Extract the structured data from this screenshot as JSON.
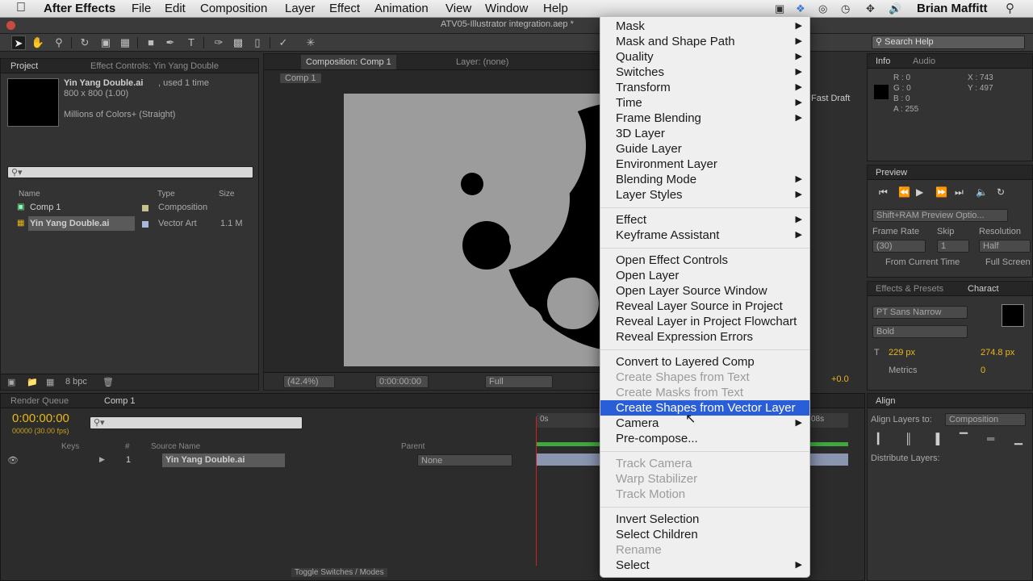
{
  "menubar": {
    "app": "After Effects",
    "items": [
      "File",
      "Edit",
      "Composition",
      "Layer",
      "Effect",
      "Animation",
      "View",
      "Window",
      "Help"
    ],
    "user": "Brian Maffitt"
  },
  "window": {
    "title": "ATV05-Illustrator integration.aep *",
    "search_placeholder": "Search Help"
  },
  "project": {
    "tab_project": "Project",
    "tab_effect": "Effect Controls: Yin Yang Double",
    "item_name": "Yin Yang Double.ai",
    "used": ", used 1 time",
    "size": "800 x 800 (1.00)",
    "colors": "Millions of Colors+ (Straight)",
    "col_name": "Name",
    "col_type": "Type",
    "col_size": "Size",
    "rows": [
      {
        "name": "Comp 1",
        "type": "Composition",
        "size": ""
      },
      {
        "name": "Yin Yang Double.ai",
        "type": "Vector Art",
        "size": "1.1 M"
      }
    ],
    "bpc": "8 bpc"
  },
  "comp": {
    "tab": "Composition: Comp 1",
    "layer_tab": "Layer: (none)",
    "crumb": "Comp 1",
    "zoom": "(42.4%)",
    "time": "0:00:00:00",
    "quality": "Full",
    "fast_draft": "Fast Draft",
    "exposure": "+0.0"
  },
  "info": {
    "tab": "Info",
    "audio_tab": "Audio",
    "r": "R : 0",
    "g": "G : 0",
    "b": "B : 0",
    "a": "A : 255",
    "x": "X : 743",
    "y": "Y : 497"
  },
  "preview": {
    "tab": "Preview",
    "ram": "Shift+RAM Preview Optio...",
    "frame_rate_label": "Frame Rate",
    "skip_label": "Skip",
    "resolution_label": "Resolution",
    "frame_rate": "(30)",
    "skip": "1",
    "resolution": "Half",
    "from_current": "From Current Time",
    "full_screen": "Full Screen"
  },
  "character": {
    "tab_effects": "Effects & Presets",
    "tab_char": "Charact",
    "font": "PT Sans Narrow",
    "style": "Bold",
    "size": "229 px",
    "leading": "274.8 px",
    "metrics": "Metrics",
    "tracking": "0"
  },
  "timeline": {
    "tab_render": "Render Queue",
    "tab_comp": "Comp 1",
    "timecode": "0:00:00:00",
    "fps": "00000 (30.00 fps)",
    "col_keys": "Keys",
    "col_num": "#",
    "col_source": "Source Name",
    "col_parent": "Parent",
    "layer_num": "1",
    "layer_name": "Yin Yang Double.ai",
    "parent": "None",
    "toggle": "Toggle Switches / Modes",
    "ruler_start": "0s",
    "ruler_end": "08s"
  },
  "align": {
    "tab": "Align",
    "align_to_label": "Align Layers to:",
    "align_to": "Composition",
    "distribute": "Distribute Layers:"
  },
  "context_menu": {
    "items": [
      {
        "label": "Mask",
        "sub": true
      },
      {
        "label": "Mask and Shape Path",
        "sub": true
      },
      {
        "label": "Quality",
        "sub": true
      },
      {
        "label": "Switches",
        "sub": true
      },
      {
        "label": "Transform",
        "sub": true
      },
      {
        "label": "Time",
        "sub": true
      },
      {
        "label": "Frame Blending",
        "sub": true
      },
      {
        "label": "3D Layer"
      },
      {
        "label": "Guide Layer"
      },
      {
        "label": "Environment Layer"
      },
      {
        "label": "Blending Mode",
        "sub": true
      },
      {
        "label": "Layer Styles",
        "sub": true
      },
      {
        "label": "Effect",
        "sub": true
      },
      {
        "label": "Keyframe Assistant",
        "sub": true
      },
      {
        "label": "Open Effect Controls"
      },
      {
        "label": "Open Layer"
      },
      {
        "label": "Open Layer Source Window"
      },
      {
        "label": "Reveal Layer Source in Project"
      },
      {
        "label": "Reveal Layer in Project Flowchart"
      },
      {
        "label": "Reveal Expression Errors"
      },
      {
        "label": "Convert to Layered Comp"
      },
      {
        "label": "Create Shapes from Text",
        "disabled": true
      },
      {
        "label": "Create Masks from Text",
        "disabled": true
      },
      {
        "label": "Create Shapes from Vector Layer",
        "highlighted": true
      },
      {
        "label": "Camera",
        "sub": true
      },
      {
        "label": "Pre-compose..."
      },
      {
        "label": "Track Camera",
        "disabled": true
      },
      {
        "label": "Warp Stabilizer",
        "disabled": true
      },
      {
        "label": "Track Motion",
        "disabled": true
      },
      {
        "label": "Invert Selection"
      },
      {
        "label": "Select Children"
      },
      {
        "label": "Rename",
        "disabled": true
      },
      {
        "label": "Select",
        "sub": true
      }
    ]
  }
}
